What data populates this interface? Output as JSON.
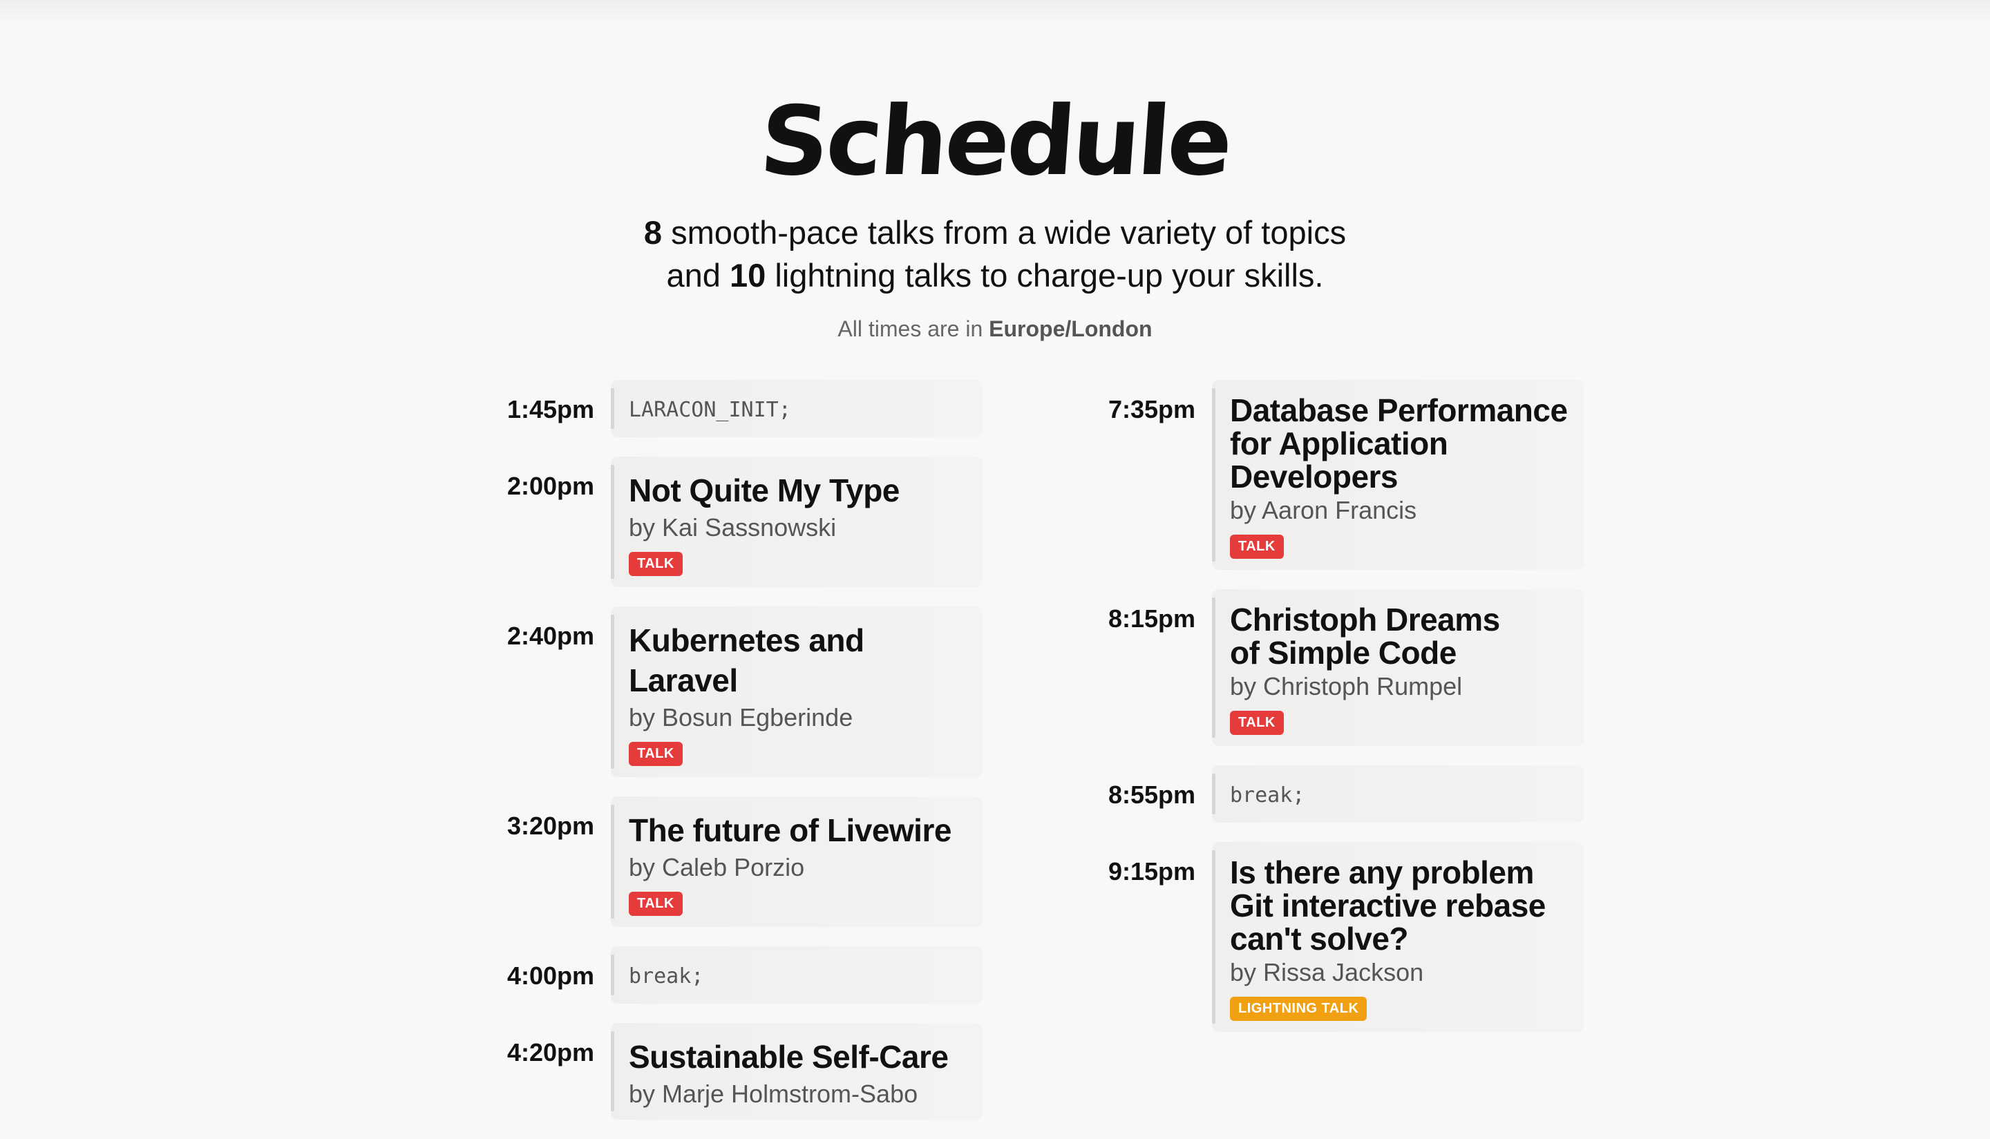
{
  "page": {
    "heading": "Schedule",
    "intro_line1_count": "8",
    "intro_line1_text": " smooth-pace talks from a wide variety of topics",
    "intro_line2_pre": "and ",
    "intro_line2_count": "10",
    "intro_line2_text": " lightning talks to charge-up your skills.",
    "timezone_prefix": "All times are in ",
    "timezone": "Europe/London"
  },
  "schedule_left": [
    {
      "time": "1:45pm",
      "code": "LARACON_INIT;"
    },
    {
      "time": "2:00pm",
      "title": "Not Quite My Type",
      "speaker": "by Kai Sassnowski",
      "badge": "TALK"
    },
    {
      "time": "2:40pm",
      "title": "Kubernetes and Laravel",
      "speaker": "by Bosun Egberinde",
      "badge": "TALK"
    },
    {
      "time": "3:20pm",
      "title": "The future of Livewire",
      "speaker": "by Caleb Porzio",
      "badge": "TALK"
    },
    {
      "time": "4:00pm",
      "code": "break;"
    },
    {
      "time": "4:20pm",
      "title": "Sustainable Self-Care",
      "speaker": "by Marje Holmstrom-Sabo"
    }
  ],
  "schedule_right": [
    {
      "time": "7:35pm",
      "title": "Database Performance for Application Developers",
      "speaker": "by Aaron Francis",
      "badge": "TALK"
    },
    {
      "time": "8:15pm",
      "title": "Christoph Dreams of Simple Code",
      "speaker": "by Christoph Rumpel",
      "badge": "TALK"
    },
    {
      "time": "8:55pm",
      "code": "break;"
    },
    {
      "time": "9:15pm",
      "title": "Is there any problem Git interactive rebase can't solve?",
      "speaker": "by Rissa Jackson",
      "badge": "LIGHTNING TALK"
    }
  ],
  "colors": {
    "talk_badge": "#e53b3b",
    "lightning_badge": "#f0a010",
    "background": "#f9f8f7"
  }
}
